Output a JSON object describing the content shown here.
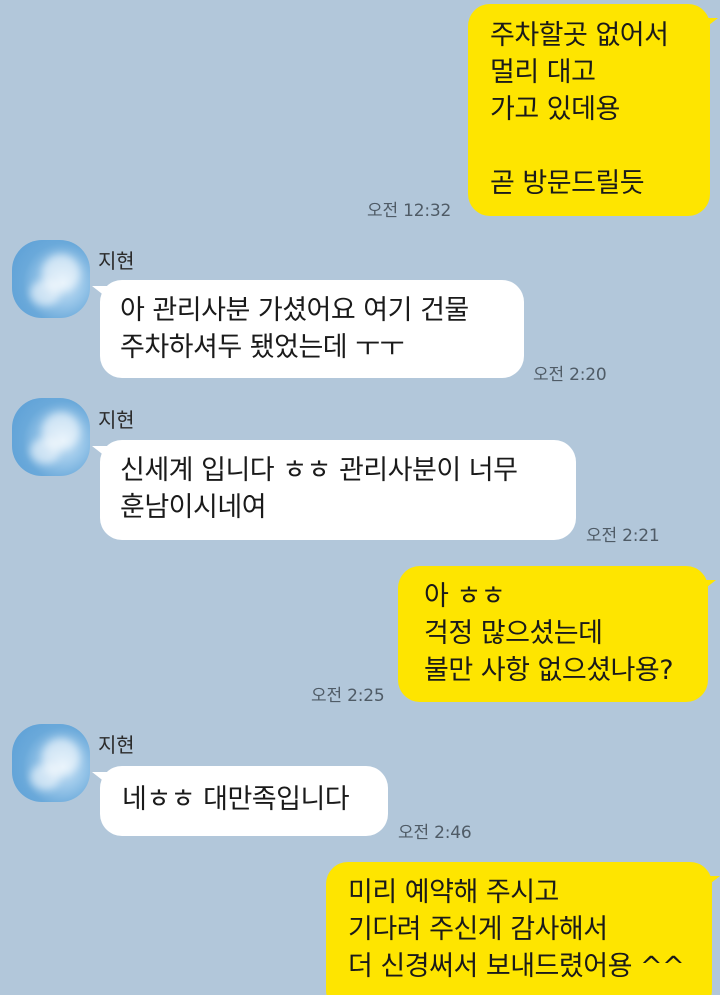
{
  "contact": {
    "name": "지현"
  },
  "messages": [
    {
      "side": "me",
      "text": "주차할곳 없어서\n멀리 대고\n가고 있데용\n\n곧 방문드릴듯",
      "time": "오전 12:32"
    },
    {
      "side": "them",
      "sender": "지현",
      "text": "아 관리사분 가셨어요 여기 건물\n주차하셔두 됐었는데 ㅜㅜ",
      "time": "오전 2:20"
    },
    {
      "side": "them",
      "sender": "지현",
      "text": "신세계 입니다 ㅎㅎ 관리사분이 너무\n훈남이시네여",
      "time": "오전 2:21"
    },
    {
      "side": "me",
      "text": "아 ㅎㅎ\n걱정 많으셨는데\n불만 사항 없으셨나용?",
      "time": "오전 2:25"
    },
    {
      "side": "them",
      "sender": "지현",
      "text": "네ㅎㅎ 대만족입니다",
      "time": "오전 2:46"
    },
    {
      "side": "me",
      "text": "미리 예약해 주시고\n기다려 주신게 감사해서\n더 신경써서 보내드렸어용 ^^",
      "time": ""
    }
  ],
  "colors": {
    "background": "#b2c7da",
    "my_bubble": "#fee500",
    "their_bubble": "#ffffff"
  },
  "icons": {
    "avatar": "profile-avatar-blurred"
  }
}
